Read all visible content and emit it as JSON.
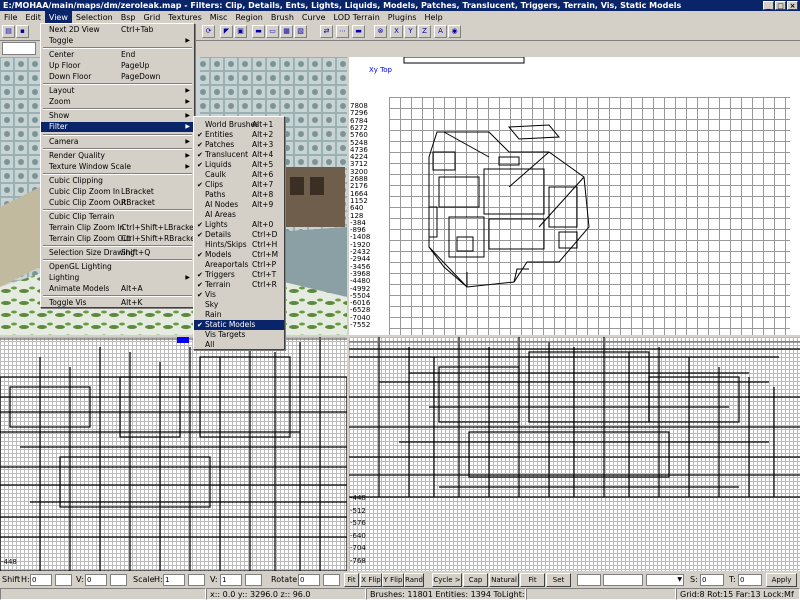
{
  "window": {
    "title": "E:/MOHAA/main/maps/dm/zeroleak.map - Filters: Clip, Details, Ents, Lights, Liquids, Models, Patches, Translucent, Triggers, Terrain, Vis, Static Models",
    "controls": [
      "_",
      "□",
      "×"
    ]
  },
  "menubar": [
    "File",
    "Edit",
    "View",
    "Selection",
    "Bsp",
    "Grid",
    "Textures",
    "Misc",
    "Region",
    "Brush",
    "Curve",
    "LOD Terrain",
    "Plugins",
    "Help"
  ],
  "toolbar2": {
    "combo_value": ""
  },
  "view_menu": [
    {
      "label": "Next 2D View",
      "shortcut": "Ctrl+Tab"
    },
    {
      "label": "Toggle",
      "submenu": true
    },
    {
      "label": "Center",
      "shortcut": "End"
    },
    {
      "label": "Up Floor",
      "shortcut": "PageUp"
    },
    {
      "label": "Down Floor",
      "shortcut": "PageDown"
    },
    {
      "label": "Layout",
      "submenu": true
    },
    {
      "label": "Zoom",
      "submenu": true
    },
    {
      "label": "Show",
      "submenu": true
    },
    {
      "label": "Filter",
      "submenu": true
    },
    {
      "label": "Camera",
      "submenu": true
    },
    {
      "label": "Render Quality",
      "submenu": true
    },
    {
      "label": "Texture Window Scale",
      "submenu": true
    },
    {
      "label": "Cubic Clipping",
      "shortcut": ""
    },
    {
      "label": "Cubic Clip Zoom In",
      "shortcut": "LBracket"
    },
    {
      "label": "Cubic Clip Zoom Out",
      "shortcut": "RBracket"
    },
    {
      "label": "Cubic Clip Terrain",
      "shortcut": ""
    },
    {
      "label": "Terrain Clip Zoom In",
      "shortcut": "Ctrl+Shift+LBracket"
    },
    {
      "label": "Terrain Clip Zoom Out",
      "shortcut": "Ctrl+Shift+RBracket"
    },
    {
      "label": "Selection Size Drawing",
      "shortcut": "Shift+Q"
    },
    {
      "label": "OpenGL Lighting",
      "shortcut": ""
    },
    {
      "label": "Lighting",
      "submenu": true
    },
    {
      "label": "Animate Models",
      "shortcut": "Alt+A"
    },
    {
      "label": "Toggle Vis",
      "shortcut": "Alt+K"
    }
  ],
  "filter_menu": [
    {
      "label": "World Brushes",
      "shortcut": "Alt+1",
      "checked": false
    },
    {
      "label": "Entities",
      "shortcut": "Alt+2",
      "checked": true
    },
    {
      "label": "Patches",
      "shortcut": "Alt+3",
      "checked": true
    },
    {
      "label": "Translucent",
      "shortcut": "Alt+4",
      "checked": true
    },
    {
      "label": "Liquids",
      "shortcut": "Alt+5",
      "checked": true
    },
    {
      "label": "Caulk",
      "shortcut": "Alt+6",
      "checked": false
    },
    {
      "label": "Clips",
      "shortcut": "Alt+7",
      "checked": true
    },
    {
      "label": "Paths",
      "shortcut": "Alt+8",
      "checked": false
    },
    {
      "label": "AI Nodes",
      "shortcut": "Alt+9",
      "checked": false
    },
    {
      "label": "AI Areas",
      "shortcut": "",
      "checked": false
    },
    {
      "label": "Lights",
      "shortcut": "Alt+0",
      "checked": true
    },
    {
      "label": "Details",
      "shortcut": "Ctrl+D",
      "checked": true
    },
    {
      "label": "Hints/Skips",
      "shortcut": "Ctrl+H",
      "checked": false
    },
    {
      "label": "Models",
      "shortcut": "Ctrl+M",
      "checked": true
    },
    {
      "label": "Areaportals",
      "shortcut": "Ctrl+P",
      "checked": false
    },
    {
      "label": "Triggers",
      "shortcut": "Ctrl+T",
      "checked": true
    },
    {
      "label": "Terrain",
      "shortcut": "Ctrl+R",
      "checked": true
    },
    {
      "label": "Vis",
      "shortcut": "",
      "checked": true
    },
    {
      "label": "Sky",
      "shortcut": "",
      "checked": false
    },
    {
      "label": "Rain",
      "shortcut": "",
      "checked": false
    },
    {
      "label": "Static Models",
      "shortcut": "",
      "checked": true,
      "highlighted": true
    },
    {
      "label": "Vis Targets",
      "shortcut": "",
      "checked": false
    },
    {
      "label": "All",
      "shortcut": "",
      "checked": false
    }
  ],
  "top_view": {
    "label": "Xy Top",
    "y_ticks": [
      "7808",
      "7296",
      "6784",
      "6272",
      "5760",
      "5248",
      "4736",
      "4224",
      "3712",
      "3200",
      "2688",
      "2176",
      "1664",
      "1152",
      "640",
      "128",
      "-384",
      "-896",
      "-1408",
      "-1920",
      "-2432",
      "-2944",
      "-3456",
      "-3968",
      "-4480",
      "-4992",
      "-5504",
      "-6016",
      "-6528",
      "-7040",
      "-7552"
    ]
  },
  "front_view": {
    "y_ticks": [
      "-448",
      "-512",
      "-576",
      "-640",
      "-704",
      "-768"
    ]
  },
  "side_view": {
    "y_ticks": [
      "-448"
    ]
  },
  "texbar": {
    "shift_label": "Shift",
    "h_label": "H:",
    "shift_h": "0",
    "v_label": "V:",
    "shift_v": "0",
    "scale_label": "Scale",
    "scale_h_label": "H:",
    "scale_h": "1",
    "scale_v_label": "V:",
    "scale_v": "1",
    "rotate_label": "Rotate:",
    "rotate": "0",
    "buttons": [
      "Fit",
      "X Flip",
      "Y Flip",
      "Rand",
      "Cycle >",
      "Cap",
      "Natural",
      "Fit",
      "Set"
    ],
    "s_label": "S:",
    "s_value": "0",
    "t_label": "T:",
    "t_value": "0",
    "apply": "Apply"
  },
  "status": {
    "coords": "x:: 0.0  y:: 3296.0  z:: 96.0",
    "counts": "Brushes: 11801 Entities: 1394 ToLight: 0",
    "grid": "Grid:8 Rot:15 Far:13 Lock:Mf"
  }
}
